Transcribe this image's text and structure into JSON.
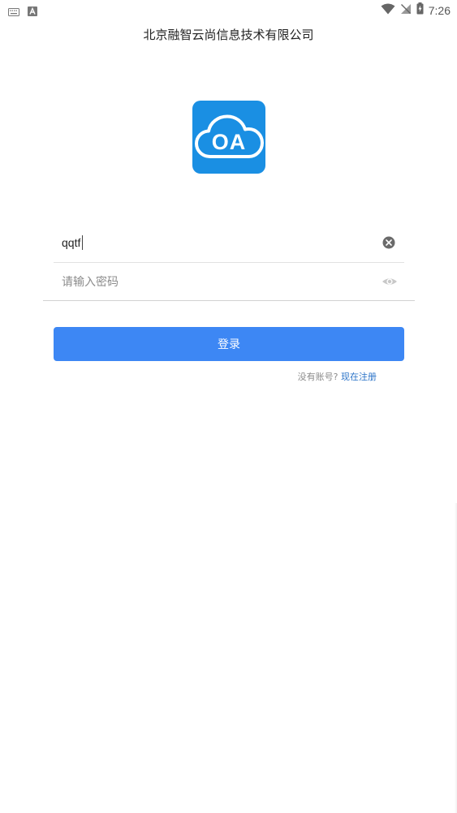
{
  "status_bar": {
    "time": "7:26",
    "left_icons": [
      "keyboard-icon",
      "a-letter-icon"
    ],
    "right_icons": [
      "wifi-icon",
      "no-sim-icon",
      "battery-charging-icon"
    ]
  },
  "header": {
    "title": "北京融智云尚信息技术有限公司"
  },
  "logo": {
    "text": "OA",
    "icon": "cloud-icon",
    "color": "#1a8fe3"
  },
  "form": {
    "username": {
      "value": "qqtf",
      "icon": "clear-icon"
    },
    "password": {
      "value": "",
      "placeholder": "请输入密码",
      "icon": "eye-icon"
    },
    "login_label": "登录",
    "login_color": "#3d87f4"
  },
  "signup": {
    "prompt": "没有账号?",
    "link": "现在注册"
  }
}
